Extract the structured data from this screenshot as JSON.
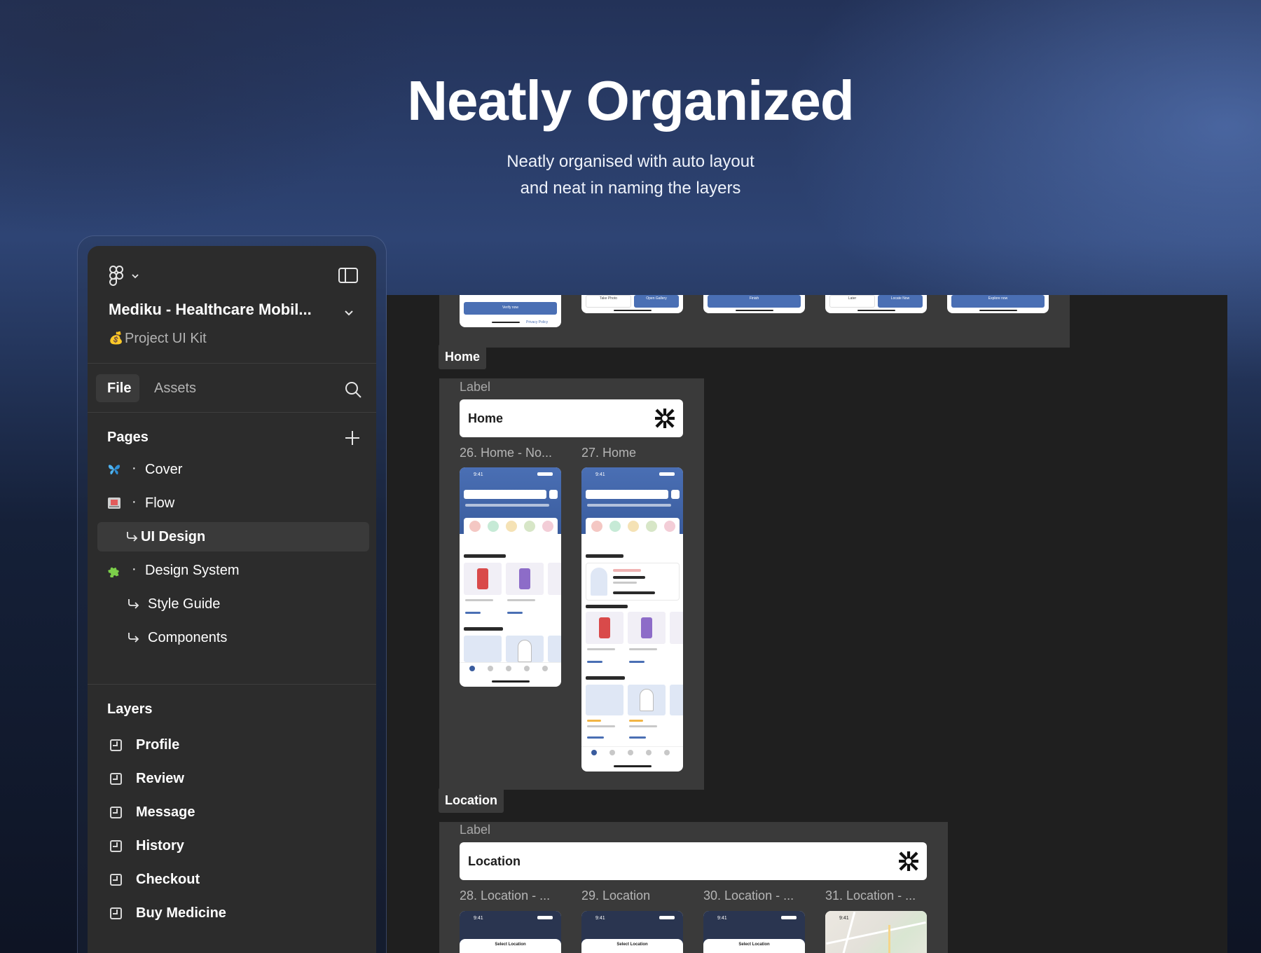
{
  "hero": {
    "title": "Neatly Organized",
    "subtitle_line1": "Neatly organised with auto layout",
    "subtitle_line2": "and neat in naming the layers"
  },
  "sidebar": {
    "project_name": "Mediku - Healthcare Mobil...",
    "project_type": "Project UI Kit",
    "tabs": {
      "file": "File",
      "assets": "Assets"
    },
    "pages_heading": "Pages",
    "pages": [
      {
        "label": "Cover",
        "icon": "butterfly-icon"
      },
      {
        "label": "Flow",
        "icon": "map-icon"
      },
      {
        "label": "UI Design",
        "icon": "return-arrow-icon"
      },
      {
        "label": "Design System",
        "icon": "puzzle-icon"
      },
      {
        "label": "Style Guide",
        "icon": "return-arrow-icon"
      },
      {
        "label": "Components",
        "icon": "return-arrow-icon"
      }
    ],
    "layers_heading": "Layers",
    "layers": [
      "Profile",
      "Review",
      "Message",
      "History",
      "Checkout",
      "Buy Medicine"
    ]
  },
  "canvas": {
    "top_buttons": [
      "Verify now",
      "Take Photo",
      "Open Gallery",
      "Finish",
      "Later",
      "Locate Now",
      "Explore now"
    ],
    "top_terms": "Privacy Policy",
    "home": {
      "tag": "Home",
      "label_title": "Label",
      "label_card": "Home",
      "frames": [
        "26. Home - No...",
        "27. Home"
      ],
      "time": "9:41"
    },
    "location": {
      "tag": "Location",
      "label_title": "Label",
      "label_card": "Location",
      "frames": [
        "28. Location - ...",
        "29. Location",
        "30. Location - ...",
        "31. Location - ..."
      ],
      "sheet_title": "Select Location",
      "time": "9:41"
    }
  },
  "colors": {
    "accent": "#4a6fb4",
    "panel": "#2c2c2c",
    "canvas": "#1f1f1f",
    "section": "#3a3a3a"
  }
}
